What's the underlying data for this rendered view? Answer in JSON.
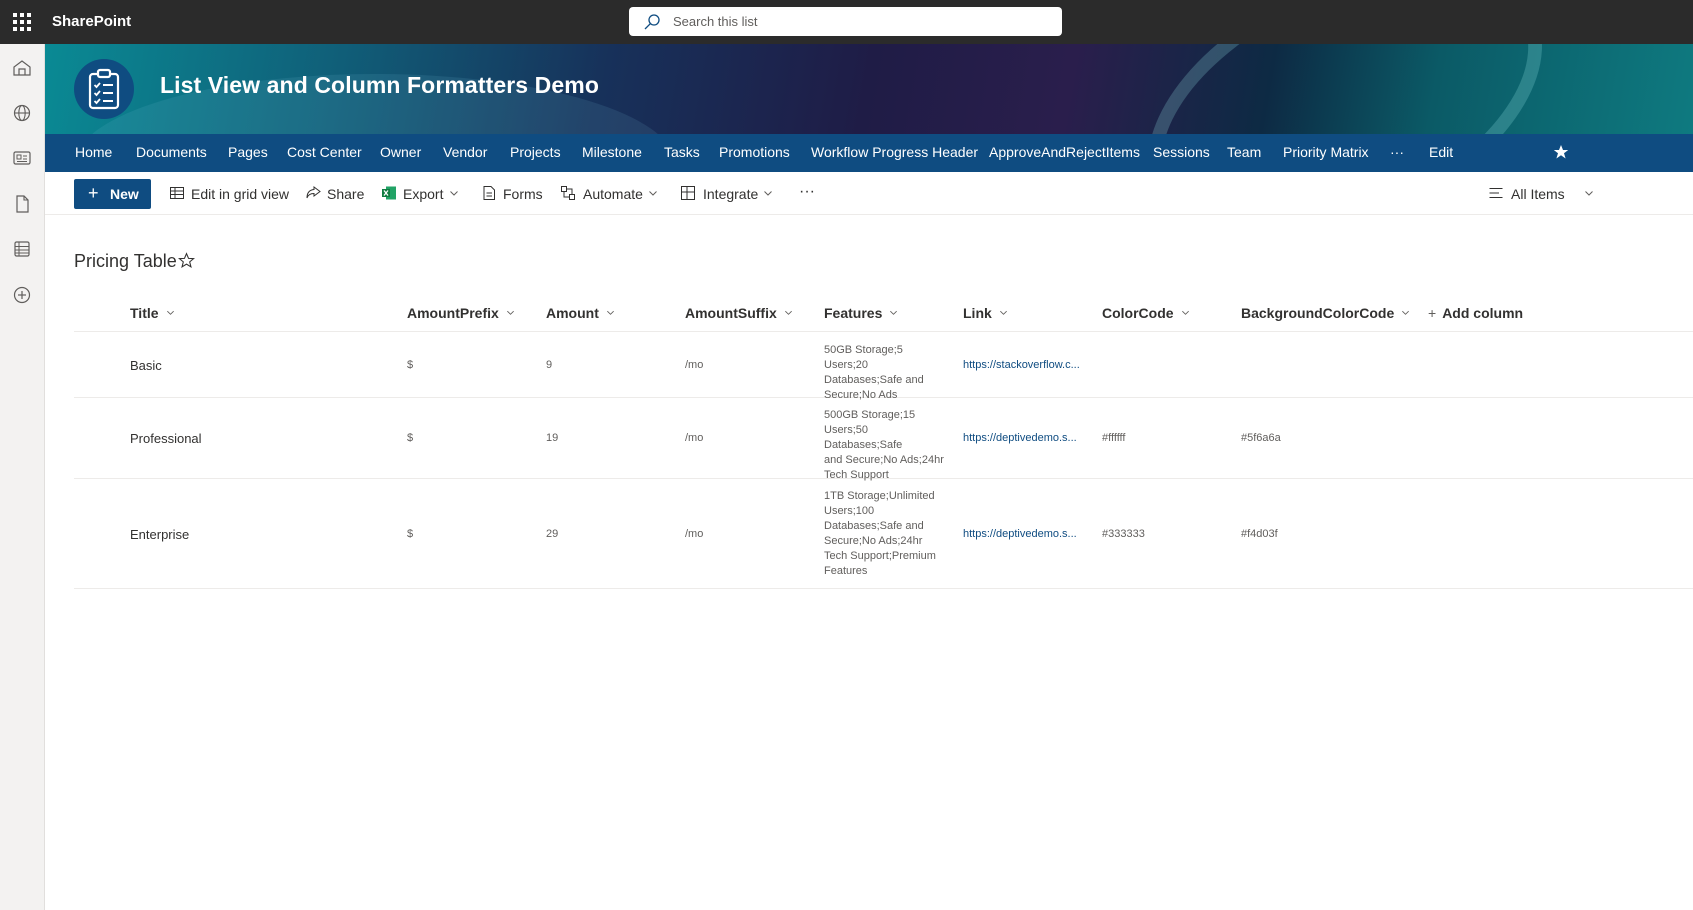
{
  "suite": {
    "app_name": "SharePoint",
    "search_placeholder": "Search this list"
  },
  "site": {
    "title": "List View and Column Formatters Demo"
  },
  "nav": {
    "items": [
      "Home",
      "Documents",
      "Pages",
      "Cost Center",
      "Owner",
      "Vendor",
      "Projects",
      "Milestone",
      "Tasks",
      "Promotions",
      "Workflow Progress Header",
      "ApproveAndRejectItems",
      "Sessions",
      "Team",
      "Priority Matrix",
      "···",
      "Edit"
    ]
  },
  "commands": {
    "new": "New",
    "edit_grid": "Edit in grid view",
    "share": "Share",
    "export": "Export",
    "forms": "Forms",
    "automate": "Automate",
    "integrate": "Integrate",
    "more": "···",
    "view": "All Items"
  },
  "list": {
    "title": "Pricing Table",
    "columns": [
      "Title",
      "AmountPrefix",
      "Amount",
      "AmountSuffix",
      "Features",
      "Link",
      "ColorCode",
      "BackgroundColorCode"
    ],
    "add_column": "Add column",
    "rows": [
      {
        "title": "Basic",
        "prefix": "$",
        "amount": "9",
        "suffix": "/mo",
        "features": [
          "50GB Storage;5 Users;20",
          "Databases;Safe and",
          "Secure;No Ads"
        ],
        "link": "https://stackoverflow.c...",
        "color": "",
        "bgcolor": ""
      },
      {
        "title": "Professional",
        "prefix": "$",
        "amount": "19",
        "suffix": "/mo",
        "features": [
          "500GB Storage;15",
          "Users;50 Databases;Safe",
          "and Secure;No Ads;24hr",
          "Tech Support"
        ],
        "link": "https://deptivedemo.s...",
        "color": "#ffffff",
        "bgcolor": "#5f6a6a"
      },
      {
        "title": "Enterprise",
        "prefix": "$",
        "amount": "29",
        "suffix": "/mo",
        "features": [
          "1TB Storage;Unlimited",
          "Users;100",
          "Databases;Safe and",
          "Secure;No Ads;24hr",
          "Tech Support;Premium",
          "Features"
        ],
        "link": "https://deptivedemo.s...",
        "color": "#333333",
        "bgcolor": "#f4d03f"
      }
    ]
  },
  "colors": {
    "suite_bar": "#2b2b2b",
    "theme": "#0f4c81",
    "link": "#0f4c81"
  },
  "icons": {
    "rail": [
      "home-icon",
      "globe-icon",
      "news-icon",
      "document-icon",
      "lists-icon",
      "create-icon"
    ]
  }
}
